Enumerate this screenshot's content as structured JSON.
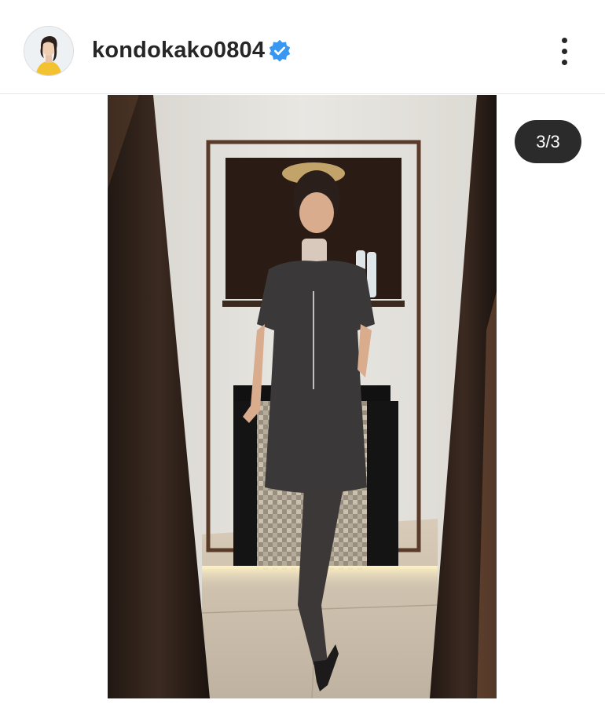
{
  "post": {
    "username": "kondokako0804",
    "verified": true,
    "more_icon": "more-vertical-icon",
    "verified_icon": "verified-badge-icon",
    "image_counter": "3/3",
    "current_image": 3,
    "total_images": 3
  },
  "colors": {
    "verified_blue": "#3897f0",
    "text": "#262626",
    "counter_bg": "#2b2b2b"
  }
}
